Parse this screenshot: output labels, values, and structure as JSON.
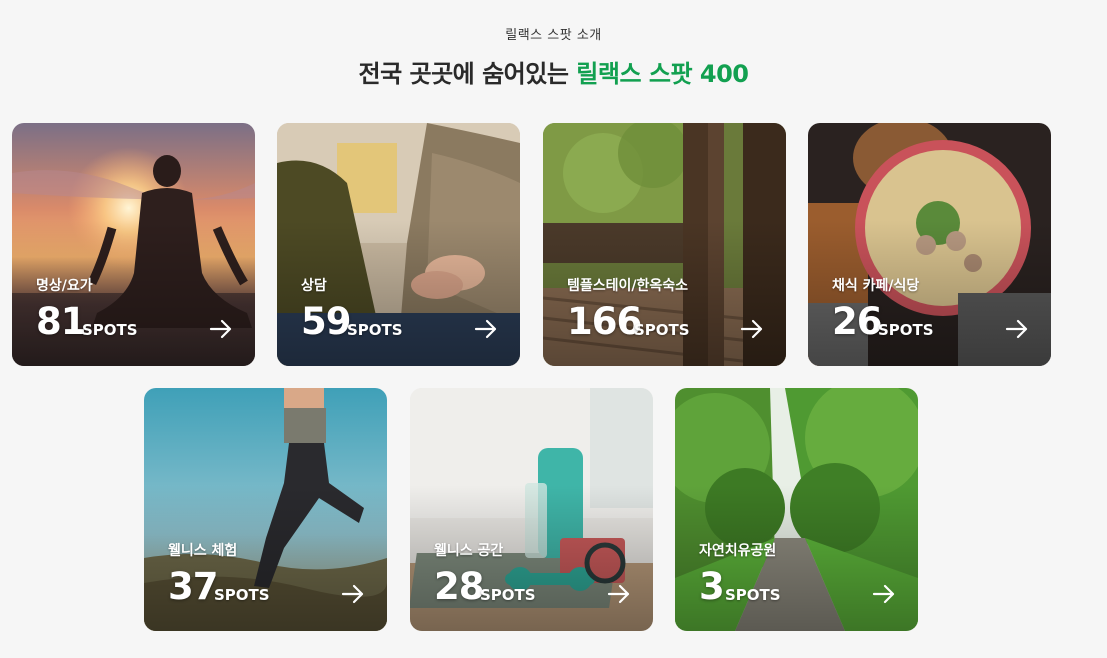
{
  "header": {
    "eyebrow": "릴랙스 스팟 소개",
    "title_prefix": "전국 곳곳에 숨어있는",
    "title_accent": "릴랙스 스팟 400"
  },
  "colors": {
    "accent": "#12a050",
    "title": "#2a2a2a",
    "background": "#f6f6f6"
  },
  "cards": [
    {
      "label": "명상/요가",
      "count": "81",
      "unit": "SPOTS",
      "icon": "arrow-right-icon"
    },
    {
      "label": "상담",
      "count": "59",
      "unit": "SPOTS",
      "icon": "arrow-right-icon"
    },
    {
      "label": "템플스테이/한옥숙소",
      "count": "166",
      "unit": "SPOTS",
      "icon": "arrow-right-icon"
    },
    {
      "label": "채식 카페/식당",
      "count": "26",
      "unit": "SPOTS",
      "icon": "arrow-right-icon"
    },
    {
      "label": "웰니스 체험",
      "count": "37",
      "unit": "SPOTS",
      "icon": "arrow-right-icon"
    },
    {
      "label": "웰니스 공간",
      "count": "28",
      "unit": "SPOTS",
      "icon": "arrow-right-icon"
    },
    {
      "label": "자연치유공원",
      "count": "3",
      "unit": "SPOTS",
      "icon": "arrow-right-icon"
    }
  ]
}
